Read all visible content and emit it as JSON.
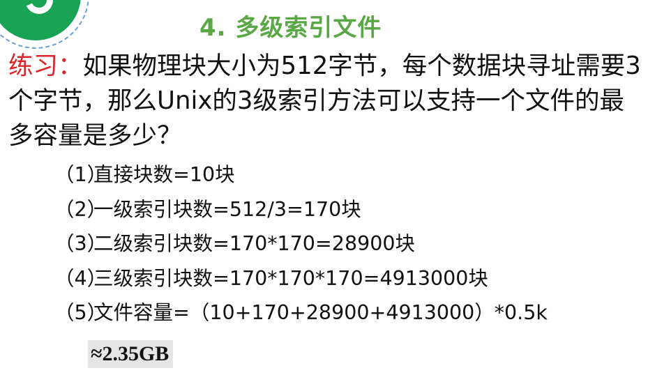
{
  "title": "4. 多级索引文件",
  "question": {
    "label": "练习：",
    "text": "如果物理块大小为512字节，每个数据块寻址需要3个字节，那么Unix的3级索引方法可以支持一个文件的最多容量是多少？"
  },
  "steps": [
    {
      "num": "（1）",
      "text": "直接块数=10块"
    },
    {
      "num": "（2）",
      "text": "一级索引块数=512/3=170块"
    },
    {
      "num": "（3）",
      "text": "二级索引块数=170*170=28900块"
    },
    {
      "num": "（4）",
      "text": "三级索引块数=170*170*170=4913000块"
    },
    {
      "num": "（5）",
      "text": "文件容量=（10+170+28900+4913000）*0.5k"
    }
  ],
  "result": "≈2.35GB",
  "colors": {
    "title": "#5aa845",
    "label": "#d9262a",
    "badge": "#19a455",
    "result_bg": "#e5e5e5"
  }
}
